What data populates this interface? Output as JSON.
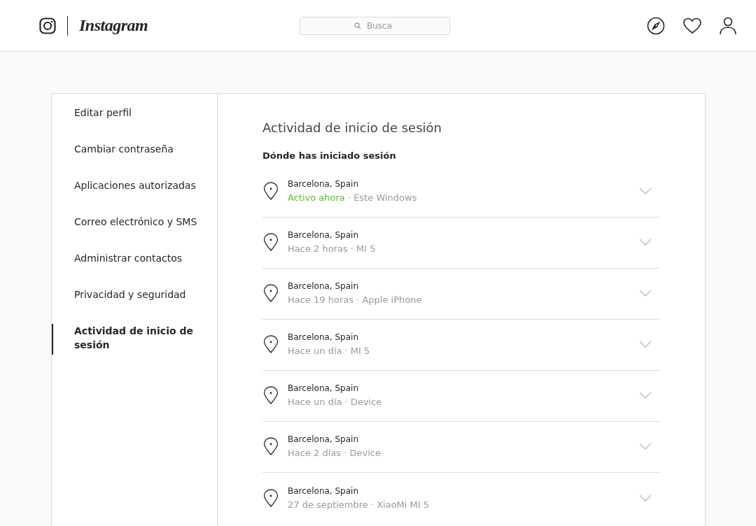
{
  "header": {
    "logo": "Instagram",
    "search": {
      "placeholder": "Busca"
    }
  },
  "sidebar": {
    "items": [
      {
        "label": "Editar perfil",
        "selected": false
      },
      {
        "label": "Cambiar contraseña",
        "selected": false
      },
      {
        "label": "Aplicaciones autorizadas",
        "selected": false
      },
      {
        "label": "Correo electrónico y SMS",
        "selected": false
      },
      {
        "label": "Administrar contactos",
        "selected": false
      },
      {
        "label": "Privacidad y seguridad",
        "selected": false
      },
      {
        "label": "Actividad de inicio de sesión",
        "selected": true
      }
    ]
  },
  "content": {
    "title": "Actividad de inicio de sesión",
    "subtitle": "Dónde has iniciado sesión",
    "sessions": [
      {
        "location": "Barcelona, Spain",
        "time": "Activo ahora",
        "device": "· Este Windows",
        "active": true
      },
      {
        "location": "Barcelona, Spain",
        "time": "Hace 2 horas",
        "device": "· MI 5",
        "active": false
      },
      {
        "location": "Barcelona, Spain",
        "time": "Hace 19 horas",
        "device": "· Apple iPhone",
        "active": false
      },
      {
        "location": "Barcelona, Spain",
        "time": "Hace un día",
        "device": "· MI 5",
        "active": false
      },
      {
        "location": "Barcelona, Spain",
        "time": "Hace un día",
        "device": "· Device",
        "active": false
      },
      {
        "location": "Barcelona, Spain",
        "time": "Hace 2 días",
        "device": "· Device",
        "active": false
      },
      {
        "location": "Barcelona, Spain",
        "time": "27 de septiembre",
        "device": "· XiaoMi MI 5",
        "active": false
      }
    ]
  }
}
